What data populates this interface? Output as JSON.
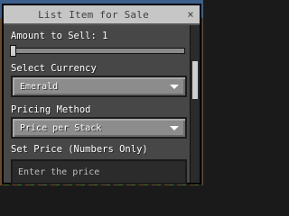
{
  "window": {
    "title": "List Item for Sale",
    "close_glyph": "×"
  },
  "amount": {
    "label": "Amount to Sell: 1",
    "value": 1
  },
  "currency": {
    "label": "Select Currency",
    "selected": "Emerald"
  },
  "pricing": {
    "label": "Pricing Method",
    "selected": "Price per Stack"
  },
  "price": {
    "label": "Set Price (Numbers Only)",
    "placeholder": "Enter the price"
  },
  "icons": {
    "close": "close-icon",
    "dropdown": "chevron-down-icon"
  }
}
